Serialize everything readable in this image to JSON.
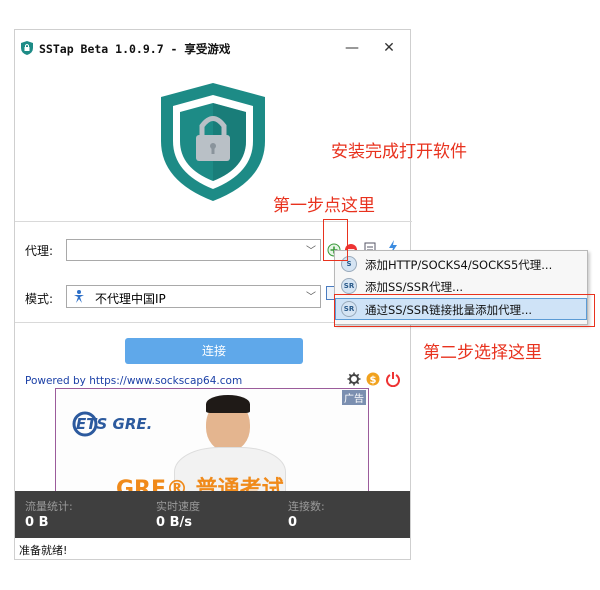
{
  "window": {
    "title": "SSTap Beta 1.0.9.7 - 享受游戏",
    "minimize": "—",
    "close": "✕"
  },
  "proxy": {
    "label": "代理:",
    "value": ""
  },
  "mode": {
    "label": "模式:",
    "value": "不代理中国IP"
  },
  "menu": {
    "items": [
      {
        "icon": "S",
        "label": "添加HTTP/SOCKS4/SOCKS5代理..."
      },
      {
        "icon": "SR",
        "label": "添加SS/SSR代理..."
      },
      {
        "icon": "SR",
        "label": "通过SS/SSR链接批量添加代理..."
      }
    ]
  },
  "annotations": {
    "step0": "安装完成打开软件",
    "step1": "第一步点这里",
    "step2": "第二步选择这里"
  },
  "connect": {
    "label": "连接"
  },
  "powered_by": "Powered by https://www.sockscap64.com",
  "ad": {
    "tag": "广告",
    "brand": "ETS GRE.",
    "headline": "GRE® 普通考试"
  },
  "stats": {
    "traffic_label": "流量统计:",
    "traffic_value": "0 B",
    "speed_label": "实时速度",
    "speed_value": "0 B/s",
    "connections_label": "连接数:",
    "connections_value": "0"
  },
  "status": "准备就绪!",
  "colors": {
    "accent_red": "#e8321e",
    "shield_teal": "#1d8b86",
    "button_blue": "#5fa8ea",
    "statbar_bg": "#3f3f3f"
  }
}
